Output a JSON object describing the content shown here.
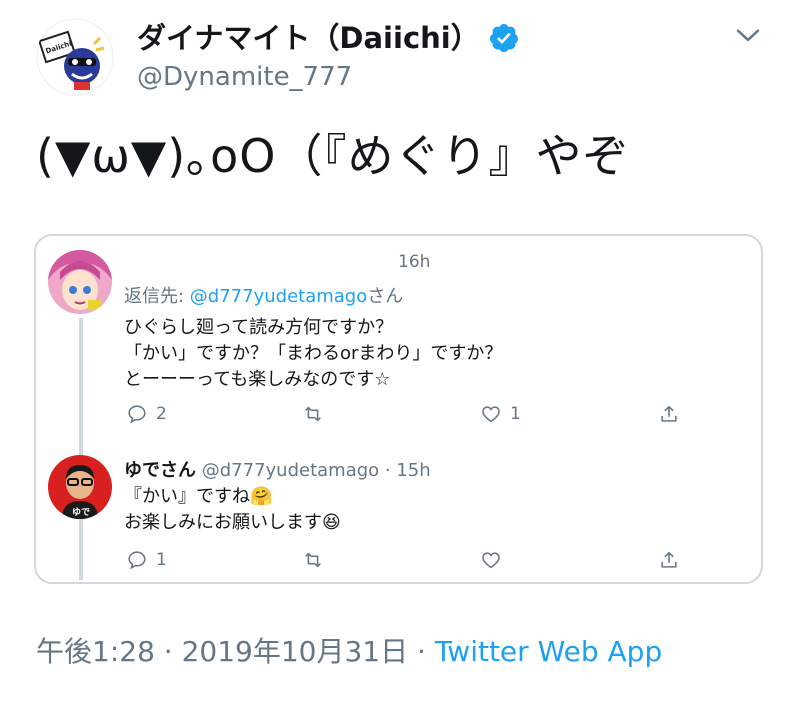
{
  "author": {
    "display_name": "ダイナマイト（Daiichi）",
    "username": "@Dynamite_777",
    "avatar_text": "Daiichi"
  },
  "tweet": {
    "text": "(▼ω▼)｡oO（『めぐり』やぞ"
  },
  "quoted": {
    "reply": {
      "time": "16h",
      "reply_prefix": "返信先: ",
      "reply_handle": "@d777yudetamago",
      "reply_suffix": "さん",
      "lines": [
        "ひぐらし廻って読み方何ですか？",
        "「かい」ですか？「まわるorまわり」ですか？",
        "とーーーっても楽しみなのです☆"
      ],
      "replies_count": "2",
      "likes_count": "1"
    },
    "yude": {
      "name": "ゆでさん",
      "handle": "@d777yudetamago",
      "separator": " · ",
      "time": "15h",
      "avatar_text": "ゆで",
      "lines": [
        "『かい』ですね🤗",
        "お楽しみにお願いします😆"
      ],
      "replies_count": "1"
    }
  },
  "footer": {
    "time": "午後1:28",
    "sep1": " · ",
    "date": "2019年10月31日",
    "sep2": " · ",
    "source": "Twitter Web App"
  },
  "colors": {
    "accent": "#1da1f2",
    "secondary_text": "#657786",
    "border": "#cfd9de"
  }
}
